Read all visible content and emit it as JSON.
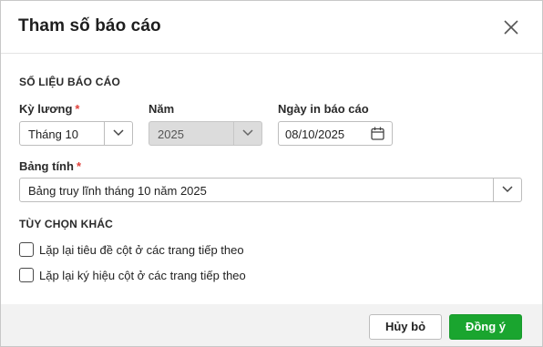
{
  "dialog": {
    "title": "Tham số báo cáo",
    "close_icon": "close-icon"
  },
  "report_data": {
    "section_label": "SỐ LIỆU BÁO CÁO",
    "pay_period": {
      "label": "Kỳ lương",
      "required_mark": "*",
      "value": "Tháng 10"
    },
    "year": {
      "label": "Năm",
      "value": "2025",
      "disabled": true
    },
    "print_date": {
      "label": "Ngày in báo cáo",
      "value": "08/10/2025",
      "icon": "calendar-icon"
    },
    "sheet": {
      "label": "Bảng tính",
      "required_mark": "*",
      "value": "Bảng truy lĩnh tháng 10 năm 2025"
    }
  },
  "other_options": {
    "section_label": "TÙY CHỌN KHÁC",
    "checkboxes": [
      {
        "label": "Lặp lại tiêu đề cột ở các trang tiếp theo",
        "checked": false
      },
      {
        "label": "Lặp lại ký hiệu cột ở các trang tiếp theo",
        "checked": false
      }
    ]
  },
  "footer": {
    "cancel_label": "Hủy bỏ",
    "ok_label": "Đồng ý"
  },
  "colors": {
    "primary_button": "#1aa52f",
    "required_mark": "#e0403a",
    "disabled_field": "#dcdcdc"
  }
}
